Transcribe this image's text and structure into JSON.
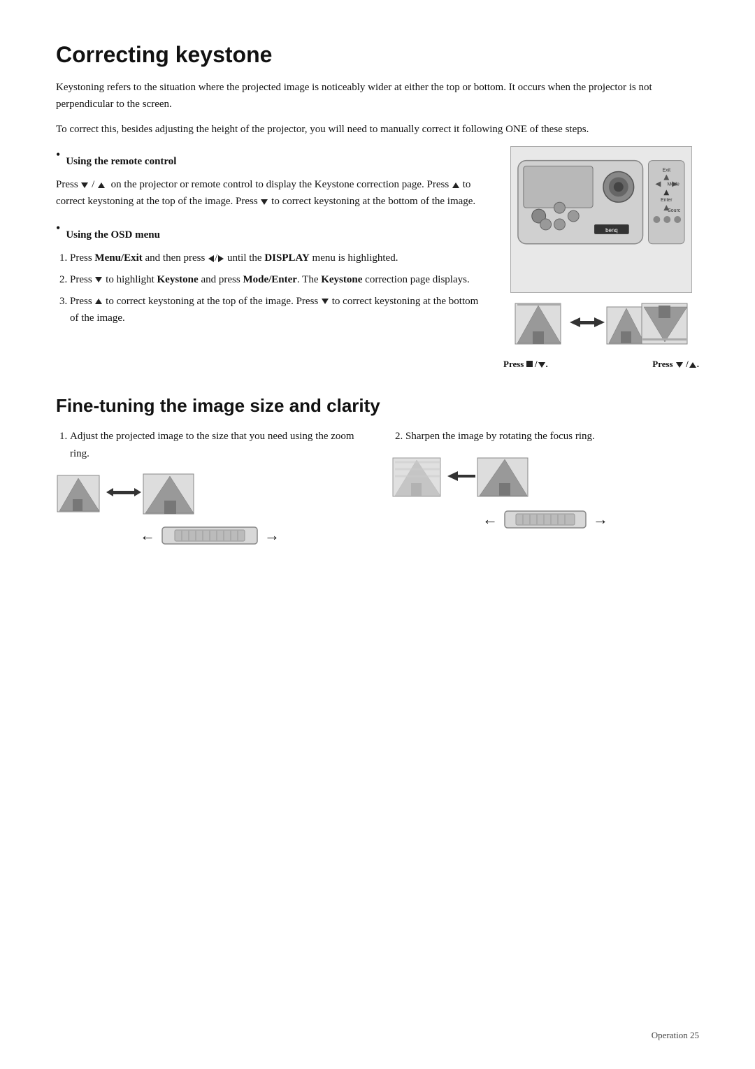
{
  "page": {
    "title": "Correcting keystone",
    "intro1": "Keystoning refers to the situation where the projected image is noticeably wider at either the top or bottom. It occurs when the projector is not perpendicular to the screen.",
    "intro2": "To correct this, besides adjusting the height of the projector, you will need to manually correct it following ONE of these steps.",
    "section1_title": "Using the remote control",
    "section1_text1": "Press",
    "section1_text1b": "/",
    "section1_text1c": "on the projector or remote control to display the Keystone correction page. Press",
    "section1_text1d": "to correct keystoning at the top of the image. Press",
    "section1_text1e": "to correct keystoning at the bottom of the image.",
    "section2_title": "Using the OSD menu",
    "osd_steps": [
      "Press Menu/Exit and then press ◄/► until the DISPLAY menu is highlighted.",
      "Press ▼ to highlight Keystone and press Mode/Enter. The Keystone correction page displays.",
      "Press ▲ to correct keystoning at the top of the image. Press ▼ to correct keystoning at the bottom of the image."
    ],
    "press_label1": "Press ■ /▼.",
    "press_label2": "Press ▼ /▲.",
    "section3_title": "Fine-tuning the image size and clarity",
    "fine_step1": "Adjust the projected image to the size that you need using the zoom ring.",
    "fine_step2": "Sharpen the image by rotating the focus ring.",
    "footer": "Operation    25"
  }
}
